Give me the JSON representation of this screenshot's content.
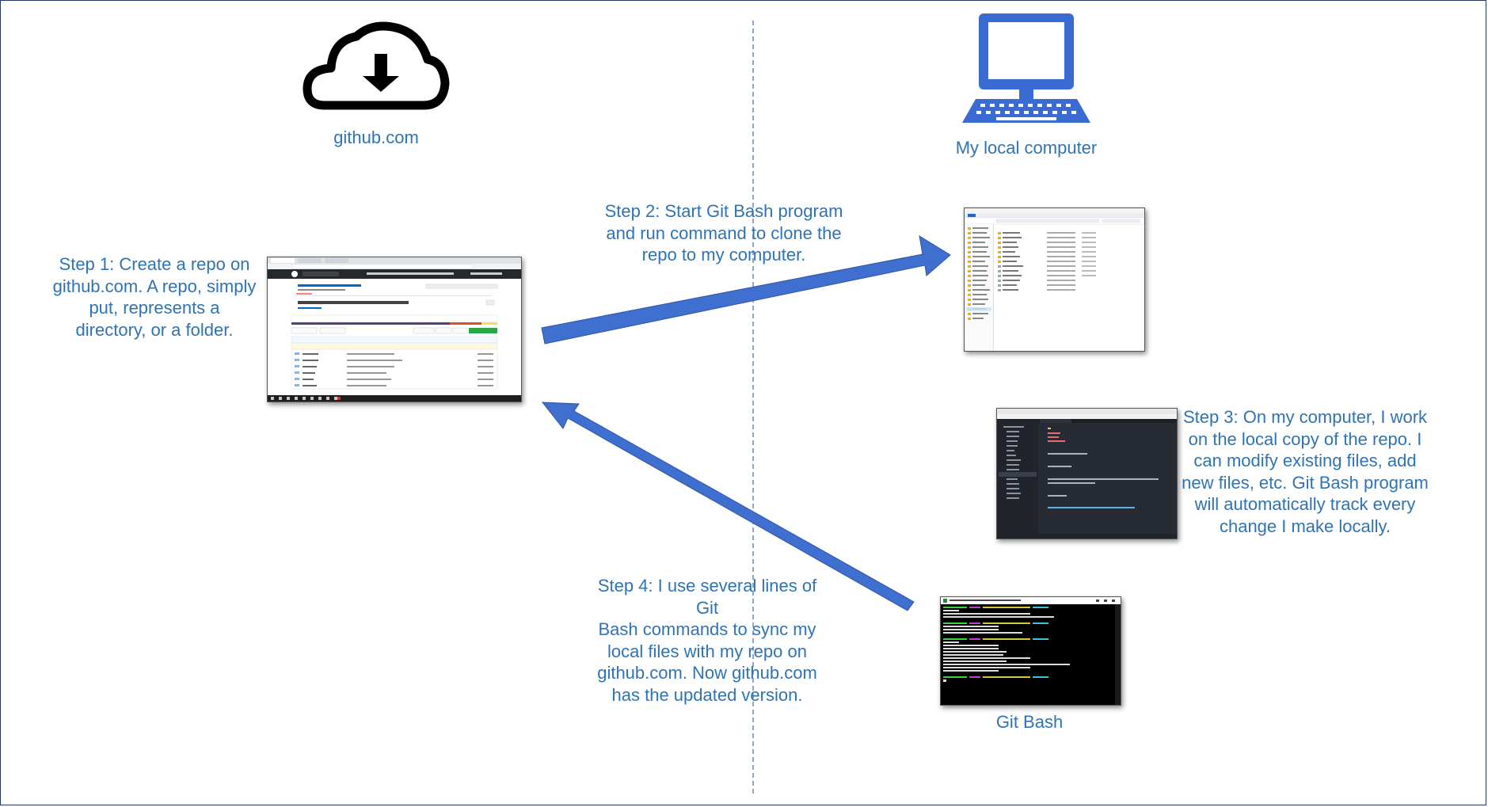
{
  "left_column": {
    "icon": "cloud-download-icon",
    "title": "github.com"
  },
  "right_column": {
    "icon": "desktop-computer-icon",
    "title": "My local computer"
  },
  "steps": {
    "step1": [
      "Step 1: Create a repo on",
      "github.com. A repo, simply",
      "put, represents a",
      "directory, or a folder."
    ],
    "step2": [
      "Step 2: Start Git Bash program",
      "and run command to clone the",
      "repo to my computer."
    ],
    "step3": [
      "Step 3: On my computer, I work",
      "on the local copy of the repo. I",
      "can modify existing files, add",
      "new files, etc. Git Bash program",
      "will automatically track every",
      "change I make locally."
    ],
    "step4": [
      "Step 4: I use several lines of Git",
      "Bash commands to sync my",
      "local files with my repo on",
      "github.com. Now github.com",
      "has the updated version."
    ]
  },
  "git_bash_caption": "Git Bash",
  "colors": {
    "text_blue": "#2e74b5",
    "arrow_blue": "#3f6fcf",
    "icon_blue": "#3a6bd2",
    "frame": "#1f3a68"
  }
}
